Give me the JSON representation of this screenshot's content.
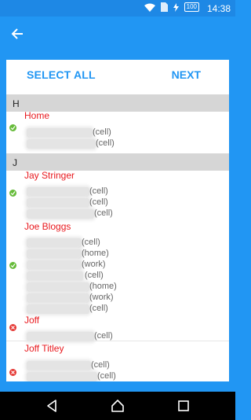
{
  "status_bar": {
    "battery": "100",
    "time": "14:38"
  },
  "actions": {
    "select_all": "SELECT ALL",
    "next": "NEXT"
  },
  "sections": [
    {
      "letter": "H"
    },
    {
      "letter": "J"
    }
  ],
  "contacts": [
    {
      "name": "Home",
      "status": "ok",
      "labels": [
        "(cell)",
        "(cell)"
      ]
    },
    {
      "name": "Jay Stringer",
      "status": "ok",
      "labels": [
        "(cell)",
        "(cell)",
        "(cell)"
      ]
    },
    {
      "name": "Joe Bloggs",
      "status": "ok",
      "labels": [
        "(cell)",
        "(home)",
        "(work)",
        "(cell)",
        "(home)",
        "(work)",
        "(cell)"
      ]
    },
    {
      "name": "Joff",
      "status": "error",
      "labels": [
        "(cell)"
      ]
    },
    {
      "name": "Joff Titley",
      "status": "error",
      "labels": [
        "(cell)",
        "(cell)"
      ]
    }
  ],
  "colors": {
    "primary": "#2196F3",
    "name": "#E8191E",
    "ok": "#66BB3A",
    "error": "#E53935"
  },
  "icons": {
    "back": "arrow-left-icon",
    "ok": "check-circle-icon",
    "error": "close-circle-icon"
  }
}
